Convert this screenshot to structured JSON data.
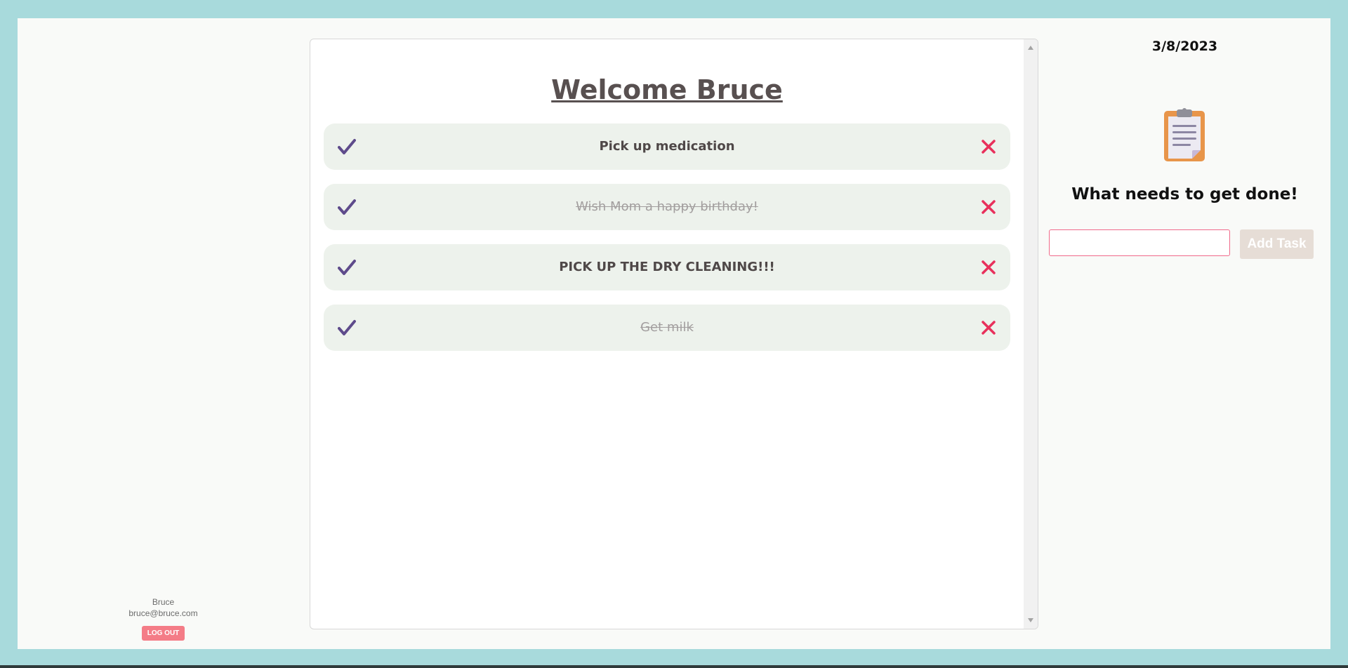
{
  "user": {
    "name": "Bruce",
    "email": "bruce@bruce.com",
    "logout_label": "LOG OUT"
  },
  "main": {
    "welcome": "Welcome Bruce",
    "tasks": [
      {
        "text": "Pick up medication",
        "done": false
      },
      {
        "text": "Wish Mom a happy birthday!",
        "done": true
      },
      {
        "text": "PICK UP THE DRY CLEANING!!!",
        "done": false
      },
      {
        "text": "Get milk",
        "done": true
      }
    ]
  },
  "sidebar": {
    "date": "3/8/2023",
    "prompt": "What needs to get done!",
    "input_value": "",
    "add_label": "Add Task"
  },
  "icons": {
    "check": "check-icon",
    "delete": "close-icon",
    "clipboard": "clipboard-icon"
  },
  "colors": {
    "background": "#a8dadc",
    "check": "#5e4b8b",
    "delete": "#e8305b",
    "task_bg": "#edf2ec",
    "logout": "#f47c87"
  }
}
